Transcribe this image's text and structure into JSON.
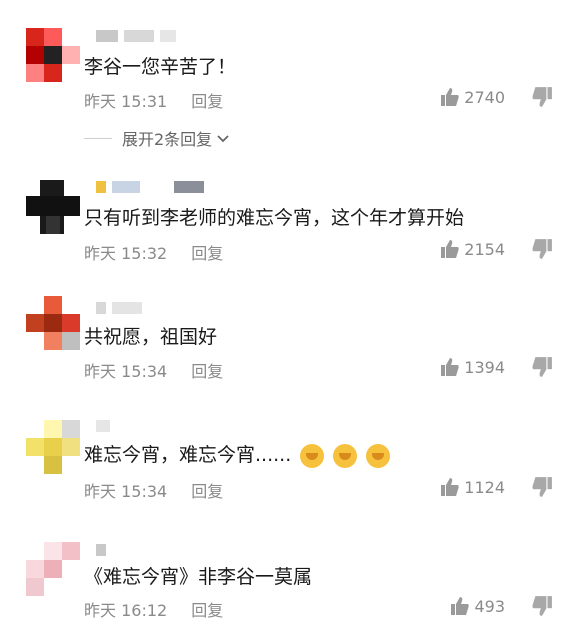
{
  "comments": [
    {
      "text": "李谷一您辛苦了！",
      "time": "昨天 15:31",
      "reply": "回复",
      "likes": "2740",
      "avatar_colors": [
        "#d9261c",
        "#222222",
        "#ff5a5a",
        "#b30000",
        "#ffb0b0"
      ]
    },
    {
      "text": "只有听到李老师的难忘今宵，这个年才算开始",
      "time": "昨天 15:32",
      "reply": "回复",
      "likes": "2154",
      "avatar_colors": [
        "#111111",
        "#2a2a2a",
        "#444444",
        "#000000",
        "#333333"
      ]
    },
    {
      "text": "共祝愿，祖国好",
      "time": "昨天 15:34",
      "reply": "回复",
      "likes": "1394",
      "avatar_colors": [
        "#e85a3a",
        "#9c2a10",
        "#d93a2a",
        "#f08060",
        "#c04020"
      ]
    },
    {
      "text": "难忘今宵，难忘今宵......",
      "time": "昨天 15:34",
      "reply": "回复",
      "likes": "1124",
      "avatar_colors": [
        "#f3e26a",
        "#e8d04a",
        "#fff6b0",
        "#d8c040",
        "#f0e080"
      ]
    },
    {
      "text": "《难忘今宵》非李谷一莫属",
      "time": "昨天 16:12",
      "reply": "回复",
      "likes": "493",
      "avatar_colors": [
        "#f4c0c8",
        "#f8d8dc",
        "#eeb0b8",
        "#fbe4e8",
        "#f0c8d0"
      ]
    }
  ],
  "expand": {
    "label": "展开2条回复"
  },
  "colors": {
    "meta": "#8a8a8a",
    "text": "#1a1a1a"
  }
}
